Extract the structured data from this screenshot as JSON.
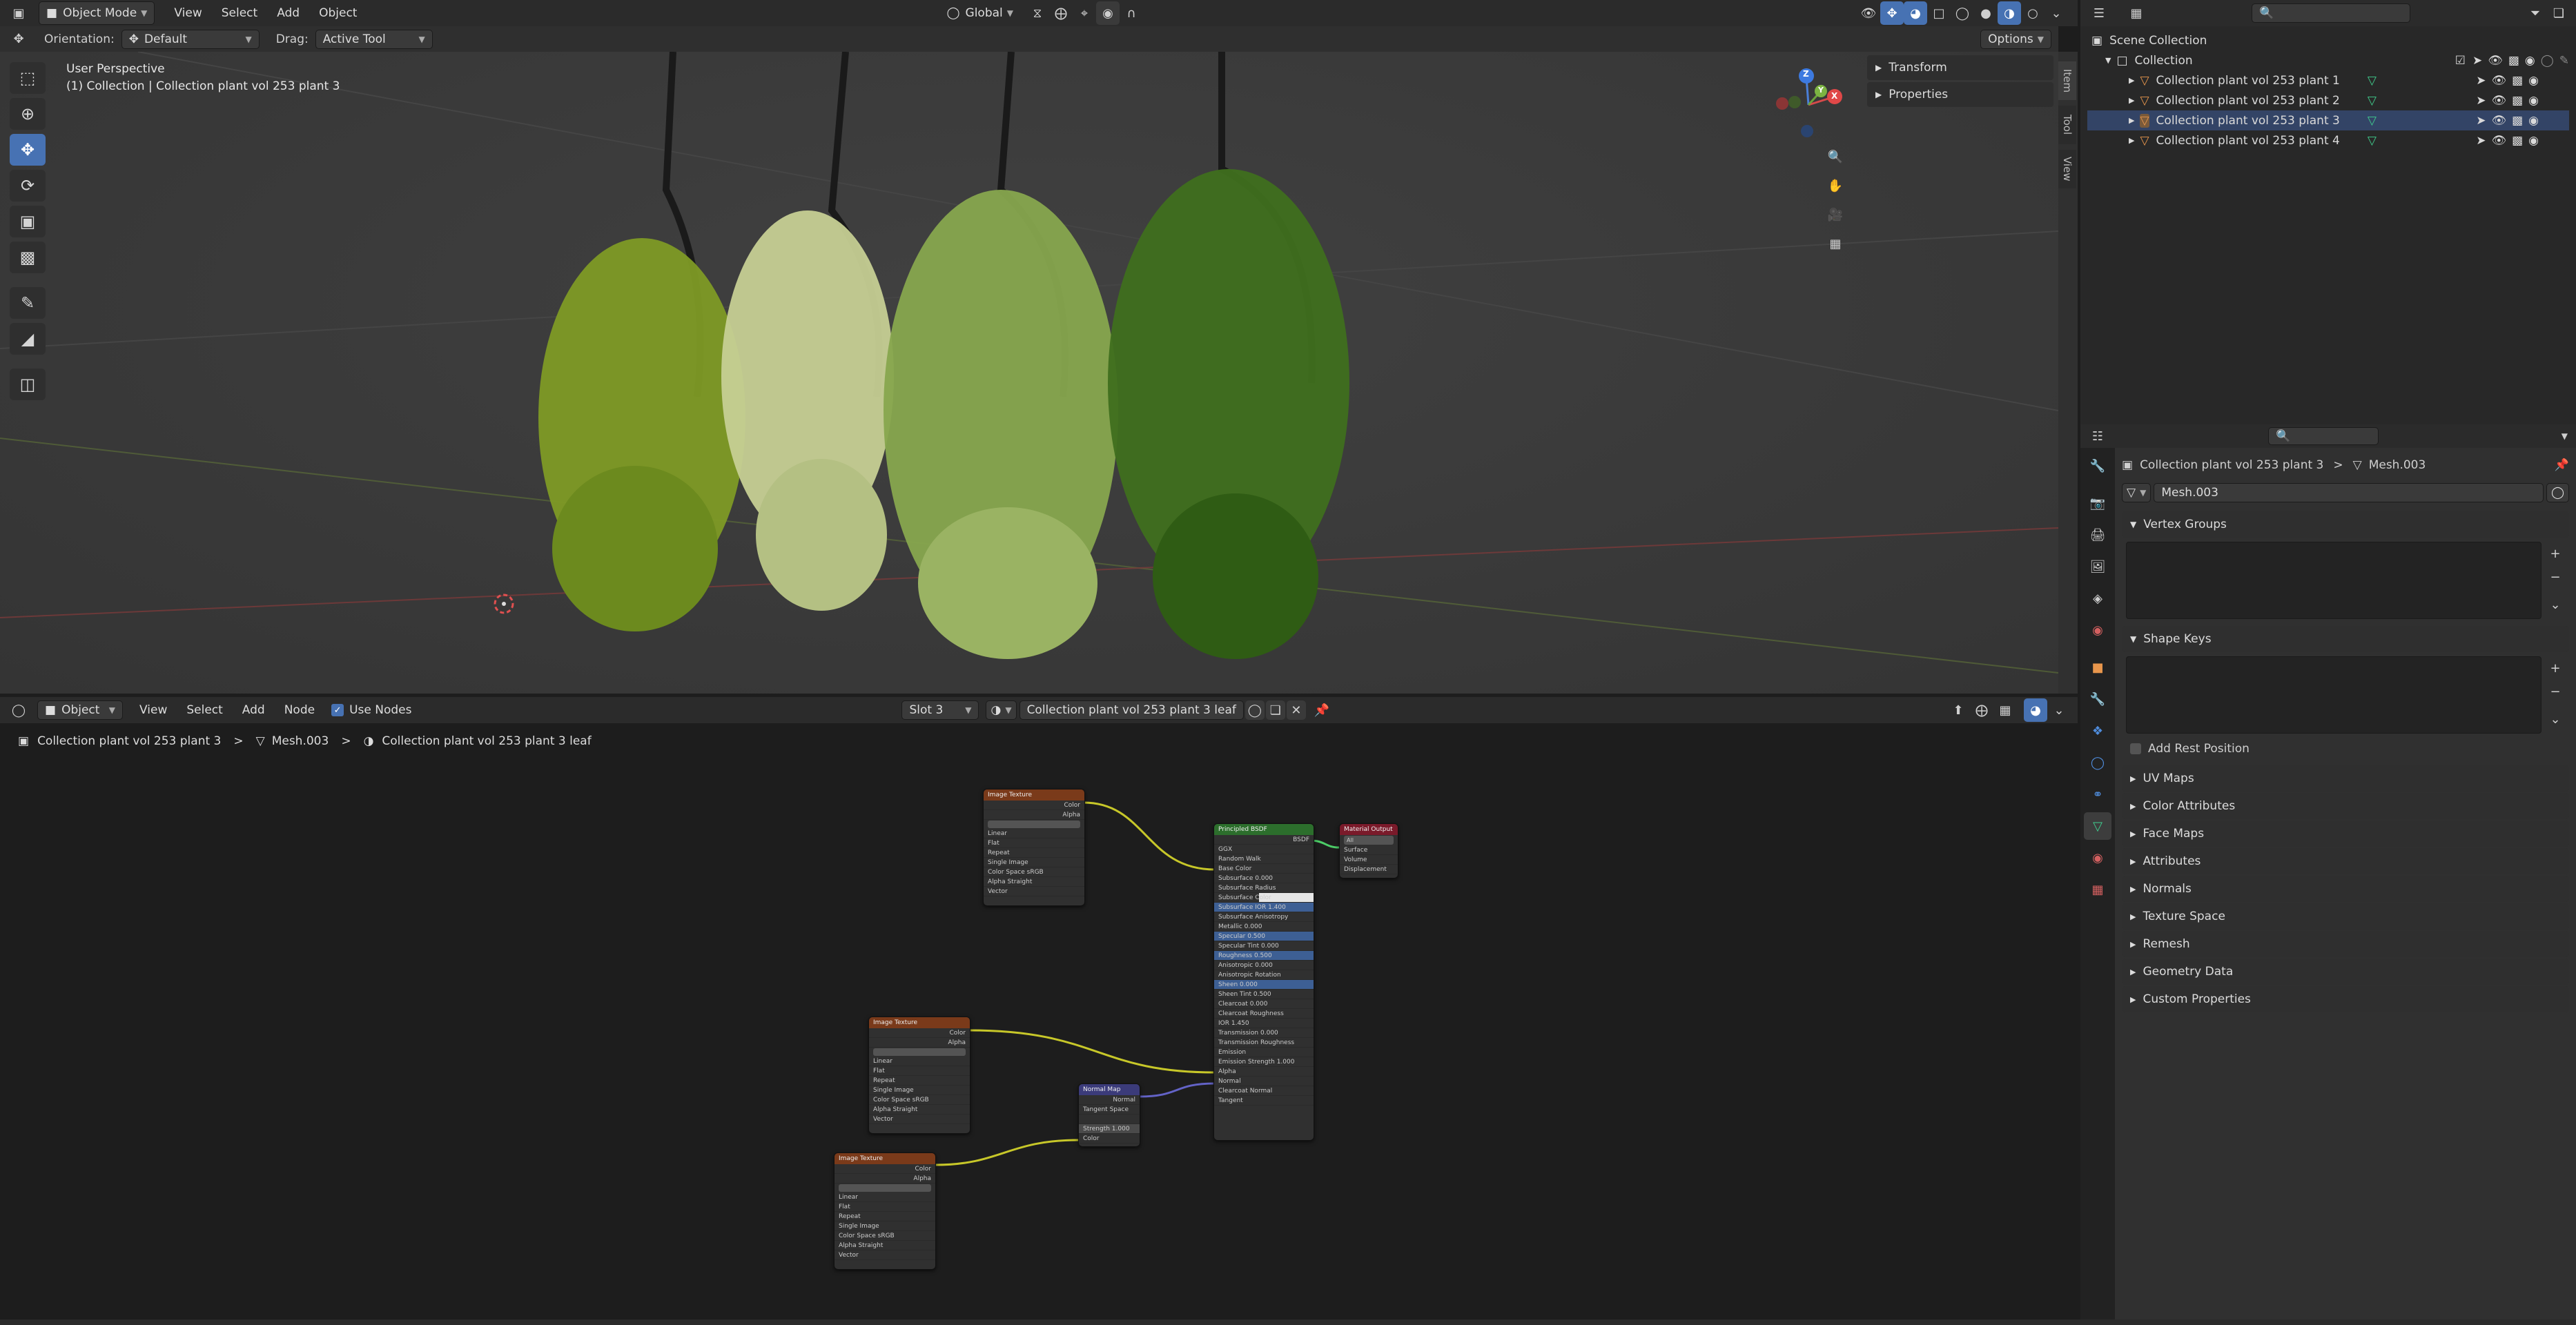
{
  "topbar": {
    "mode": "Object Mode",
    "menus": [
      "View",
      "Select",
      "Add",
      "Object"
    ],
    "transform_orientation": "Global",
    "options_label": "Options"
  },
  "tool_header": {
    "orientation_label": "Orientation:",
    "orientation_value": "Default",
    "drag_label": "Drag:",
    "drag_value": "Active Tool"
  },
  "viewport": {
    "view_name": "User Perspective",
    "collection_info": "(1) Collection | Collection plant vol 253 plant 3",
    "npanel": {
      "items": [
        "Transform",
        "Properties"
      ],
      "tabs": [
        "Item",
        "Tool",
        "View"
      ]
    },
    "gizmo_axes": [
      "Z",
      "Y",
      "X"
    ]
  },
  "outliner": {
    "root": "Scene Collection",
    "collection": "Collection",
    "items": [
      "Collection plant vol 253 plant 1",
      "Collection plant vol 253 plant 2",
      "Collection plant vol 253 plant 3",
      "Collection plant vol 253 plant 4"
    ]
  },
  "properties": {
    "breadcrumb_object": "Collection plant vol 253 plant 3",
    "breadcrumb_mesh": "Mesh.003",
    "datablock_name": "Mesh.003",
    "panels": {
      "vertex_groups": "Vertex Groups",
      "shape_keys": "Shape Keys",
      "add_rest_position": "Add Rest Position",
      "collapsed": [
        "UV Maps",
        "Color Attributes",
        "Face Maps",
        "Attributes",
        "Normals",
        "Texture Space",
        "Remesh",
        "Geometry Data",
        "Custom Properties"
      ]
    }
  },
  "node_editor": {
    "header": {
      "object_type": "Object",
      "menus": [
        "View",
        "Select",
        "Add",
        "Node"
      ],
      "use_nodes_label": "Use Nodes",
      "slot": "Slot 3",
      "material": "Collection plant vol 253 plant 3 leaf"
    },
    "breadcrumb": {
      "object": "Collection plant vol 253 plant 3",
      "mesh": "Mesh.003",
      "material": "Collection plant vol 253 plant 3 leaf"
    },
    "nodes": {
      "image1": {
        "title": "Image Texture",
        "out1": "Color",
        "out2": "Alpha",
        "rows": [
          "Linear",
          "Flat",
          "Repeat",
          "Single Image",
          "Color Space  sRGB",
          "Alpha  Straight",
          "Vector"
        ]
      },
      "image2": {
        "title": "Image Texture",
        "out1": "Color",
        "out2": "Alpha",
        "rows": [
          "Linear",
          "Flat",
          "Repeat",
          "Single Image",
          "Color Space  sRGB",
          "Alpha  Straight",
          "Vector"
        ]
      },
      "image3": {
        "title": "Image Texture",
        "out1": "Color",
        "out2": "Alpha",
        "rows": [
          "Linear",
          "Flat",
          "Repeat",
          "Single Image",
          "Color Space  sRGB",
          "Alpha  Straight",
          "Vector"
        ]
      },
      "normal": {
        "title": "Normal Map",
        "out": "Normal",
        "rows": [
          "Tangent Space",
          "",
          "Strength  1.000",
          "Color"
        ]
      },
      "bsdf": {
        "title": "Principled BSDF",
        "out": "BSDF",
        "rows": [
          "GGX",
          "Random Walk",
          "Base Color",
          "Subsurface  0.000",
          "Subsurface Radius",
          "Subsurface Color",
          "Subsurface IOR  1.400",
          "Subsurface Anisotropy",
          "Metallic  0.000",
          "Specular  0.500",
          "Specular Tint  0.000",
          "Roughness  0.500",
          "Anisotropic  0.000",
          "Anisotropic Rotation",
          "Sheen  0.000",
          "Sheen Tint  0.500",
          "Clearcoat  0.000",
          "Clearcoat Roughness",
          "IOR  1.450",
          "Transmission  0.000",
          "Transmission Roughness",
          "Emission",
          "Emission Strength  1.000",
          "Alpha",
          "Normal",
          "Clearcoat Normal",
          "Tangent"
        ]
      },
      "output": {
        "title": "Material Output",
        "target": "All",
        "rows": [
          "Surface",
          "Volume",
          "Displacement"
        ]
      }
    }
  }
}
